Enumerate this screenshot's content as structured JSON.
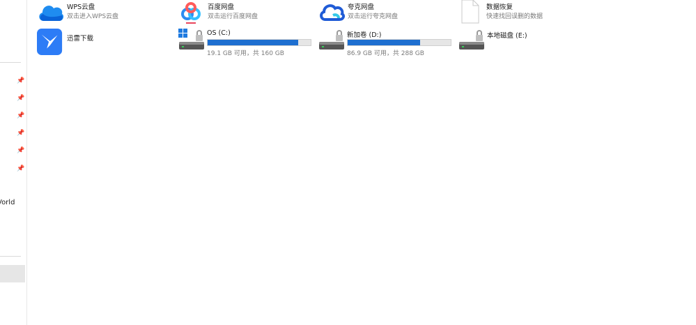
{
  "sidebar": {
    "pins": [
      "★",
      "★",
      "★",
      "★",
      "★",
      "★"
    ],
    "partial_label": "Vorld"
  },
  "apps": [
    {
      "title": "WPS云盘",
      "subtitle": "双击进入WPS云盘",
      "icon": "wps-cloud-icon"
    },
    {
      "title": "百度网盘",
      "subtitle": "双击运行百度网盘",
      "icon": "baidu-netdisk-icon"
    },
    {
      "title": "夸克网盘",
      "subtitle": "双击运行夸克网盘",
      "icon": "quark-netdisk-icon"
    },
    {
      "title": "数据恢复",
      "subtitle": "快速找回误删的数据",
      "icon": "document-icon"
    },
    {
      "title": "迅雷下载",
      "subtitle": "",
      "icon": "thunder-download-icon"
    }
  ],
  "drives": [
    {
      "label": "OS (C:)",
      "space": "19.1 GB 可用，共 160 GB",
      "used_fraction": 0.88,
      "icon": "windows-drive-icon"
    },
    {
      "label": "新加卷 (D:)",
      "space": "86.9 GB 可用，共 288 GB",
      "used_fraction": 0.7,
      "icon": "drive-icon"
    },
    {
      "label": "本地磁盘 (E:)",
      "space": "",
      "used_fraction": null,
      "icon": "drive-icon"
    }
  ],
  "colors": {
    "usage_bar": "#1e6fd0",
    "bar_track": "#e6e6e6"
  }
}
